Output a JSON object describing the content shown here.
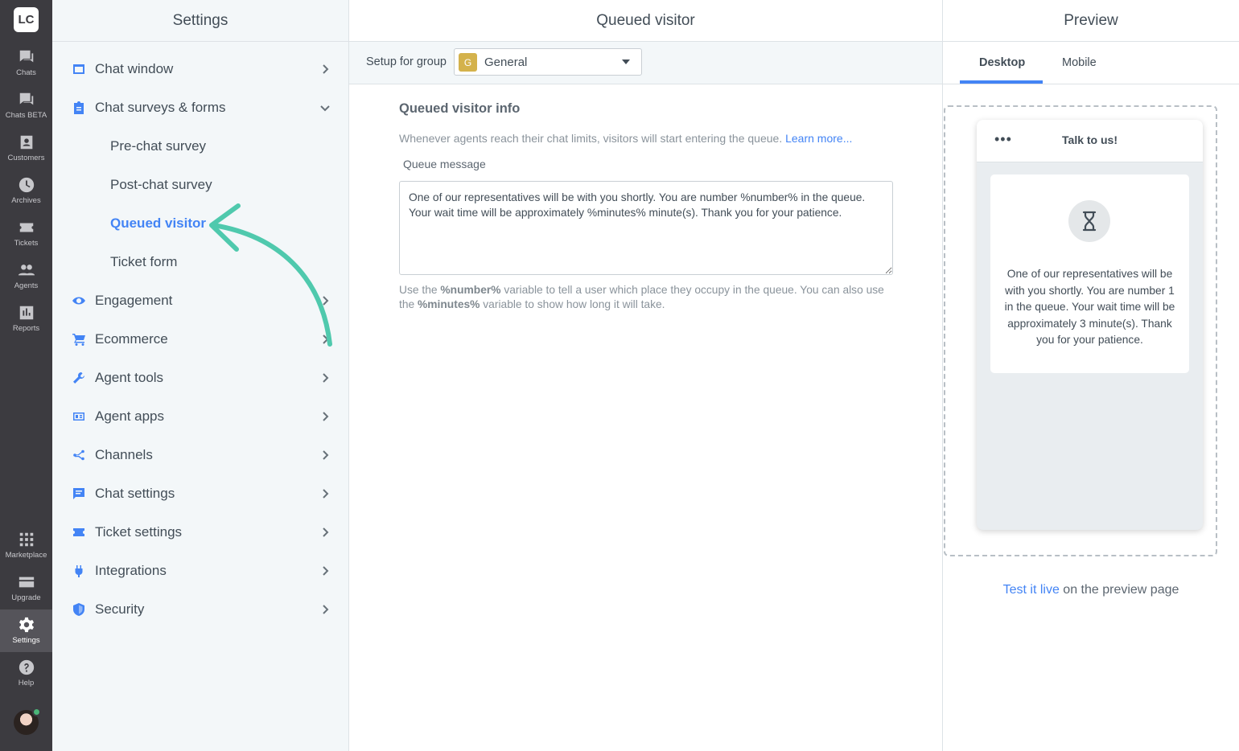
{
  "rail": {
    "logo": "LC",
    "items": [
      {
        "label": "Chats",
        "icon": "chat-icon"
      },
      {
        "label": "Chats BETA",
        "icon": "chat-beta-icon"
      },
      {
        "label": "Customers",
        "icon": "customers-icon"
      },
      {
        "label": "Archives",
        "icon": "archives-icon"
      },
      {
        "label": "Tickets",
        "icon": "tickets-icon"
      },
      {
        "label": "Agents",
        "icon": "agents-icon"
      },
      {
        "label": "Reports",
        "icon": "reports-icon"
      },
      {
        "label": "Marketplace",
        "icon": "marketplace-icon"
      },
      {
        "label": "Upgrade",
        "icon": "upgrade-icon"
      },
      {
        "label": "Settings",
        "icon": "settings-icon"
      },
      {
        "label": "Help",
        "icon": "help-icon"
      }
    ],
    "active": "Settings"
  },
  "settings": {
    "title": "Settings",
    "menu": [
      {
        "label": "Chat window",
        "icon": "window-icon"
      },
      {
        "label": "Chat surveys & forms",
        "icon": "clipboard-icon",
        "expanded": true,
        "children": [
          "Pre-chat survey",
          "Post-chat survey",
          "Queued visitor",
          "Ticket form"
        ],
        "active_child": "Queued visitor"
      },
      {
        "label": "Engagement",
        "icon": "eye-icon"
      },
      {
        "label": "Ecommerce",
        "icon": "cart-icon"
      },
      {
        "label": "Agent tools",
        "icon": "wrench-icon"
      },
      {
        "label": "Agent apps",
        "icon": "apps-icon"
      },
      {
        "label": "Channels",
        "icon": "channels-icon"
      },
      {
        "label": "Chat settings",
        "icon": "chat-settings-icon"
      },
      {
        "label": "Ticket settings",
        "icon": "ticket-icon"
      },
      {
        "label": "Integrations",
        "icon": "plug-icon"
      },
      {
        "label": "Security",
        "icon": "shield-icon"
      }
    ]
  },
  "middle": {
    "title": "Queued visitor",
    "group_label": "Setup for group",
    "group_badge": "G",
    "group_value": "General",
    "section_title": "Queued visitor info",
    "section_desc": "Whenever agents reach their chat limits, visitors will start entering the queue.",
    "learn_more": "Learn more...",
    "field_label": "Queue message",
    "queue_message": "One of our representatives will be with you shortly. You are number %number% in the queue. Your wait time will be approximately %minutes% minute(s). Thank you for your patience.",
    "hint": {
      "p1": "Use the ",
      "var1": "%number%",
      "p2": " variable to tell a user which place they occupy in the queue. You can also use the ",
      "var2": "%minutes%",
      "p3": " variable to show how long it will take."
    }
  },
  "preview": {
    "title": "Preview",
    "tabs": [
      "Desktop",
      "Mobile"
    ],
    "active_tab": "Desktop",
    "widget_menu": "•••",
    "widget_title": "Talk to us!",
    "widget_message": "One of our representatives will be with you shortly. You are number 1 in the queue. Your wait time will be approximately 3 minute(s). Thank you for your patience.",
    "test_link": "Test it live",
    "test_suffix": " on the preview page"
  },
  "colors": {
    "accent": "#4384f5",
    "rail_bg": "#3c3b40",
    "arrow": "#4fc9ad",
    "group_badge": "#d4b24c"
  }
}
